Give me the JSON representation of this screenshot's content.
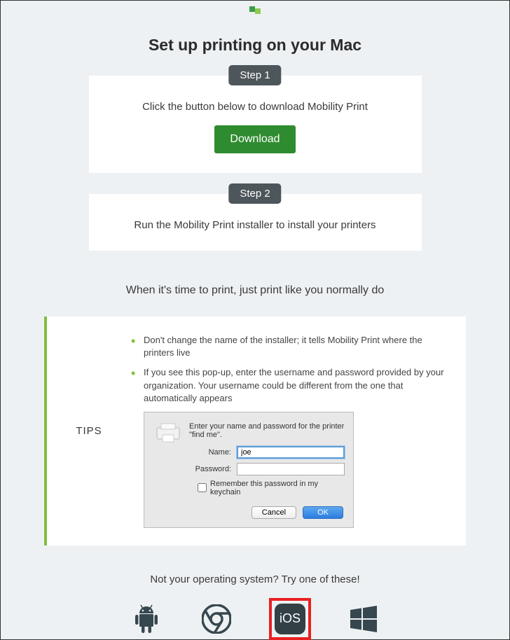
{
  "page": {
    "title": "Set up printing on your Mac"
  },
  "step1": {
    "badge": "Step 1",
    "text": "Click the button below to download Mobility Print",
    "button": "Download"
  },
  "step2": {
    "badge": "Step 2",
    "text": "Run the Mobility Print installer to install your printers"
  },
  "subtitle": "When it's time to print, just print like you normally do",
  "tips": {
    "label": "TIPS",
    "items": [
      "Don't change the name of the installer; it tells Mobility Print where the printers live",
      "If you see this pop-up, enter the username and password provided by your organization. Your username could be different from the one that automatically appears"
    ]
  },
  "popup": {
    "prompt": "Enter your name and password for the printer \"find me\".",
    "name_label": "Name:",
    "name_value": "joe",
    "password_label": "Password:",
    "remember": "Remember this password in my keychain",
    "cancel": "Cancel",
    "ok": "OK"
  },
  "os": {
    "prompt": "Not your operating system? Try one of these!",
    "ios_label": "iOS"
  }
}
